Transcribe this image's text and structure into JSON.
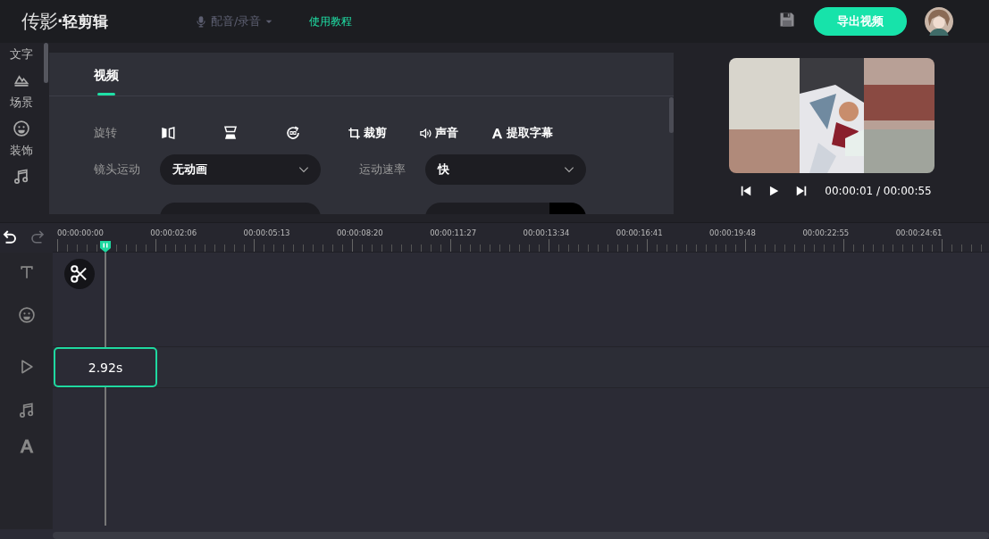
{
  "header": {
    "logo": "传影",
    "product": "·轻剪辑",
    "voice_menu": {
      "label": "配音/录音",
      "disabled": true
    },
    "tutorial_link": "使用教程",
    "export_button": "导出视频"
  },
  "sidebar": {
    "items": [
      {
        "label": "文字"
      },
      {
        "label": "场景"
      },
      {
        "label": "装饰"
      }
    ]
  },
  "panel": {
    "tabs": [
      {
        "label": "视频",
        "selected": true
      }
    ],
    "rotate_label": "旋转",
    "tools": [
      {
        "label": "裁剪"
      },
      {
        "label": "声音"
      },
      {
        "label": "提取字幕"
      }
    ],
    "fields": [
      {
        "label": "镜头运动",
        "value": "无动画"
      },
      {
        "label": "运动速率",
        "value": "快"
      }
    ]
  },
  "preview": {
    "time": "00:00:01 / 00:00:55"
  },
  "timeline": {
    "ruler": [
      "00:00:00:00",
      "00:00:02:06",
      "00:00:05:13",
      "00:00:08:20",
      "00:00:11:27",
      "00:00:13:34",
      "00:00:16:41",
      "00:00:19:48",
      "00:00:22:55",
      "00:00:24:61"
    ],
    "tracks": [
      {
        "kind": "text"
      },
      {
        "kind": "sticker"
      },
      {
        "kind": "video",
        "clip": "2.92s"
      },
      {
        "kind": "audio"
      },
      {
        "kind": "subtitle"
      }
    ]
  }
}
